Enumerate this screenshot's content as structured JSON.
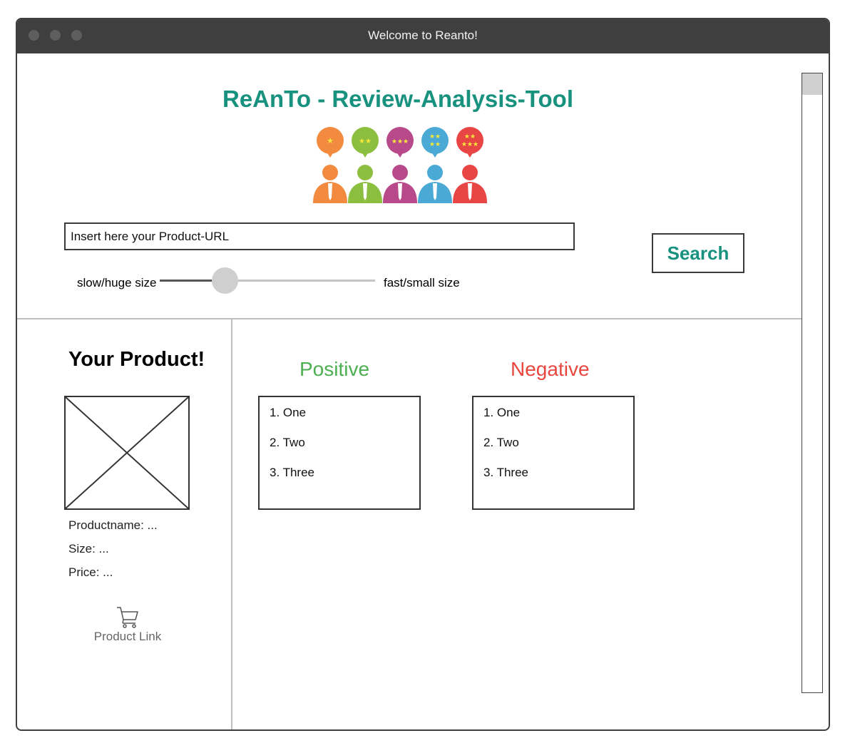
{
  "window": {
    "title": "Welcome to Reanto!"
  },
  "header": {
    "app_title": "ReAnTo - Review-Analysis-Tool",
    "logo_icon": "review-people-logo-icon"
  },
  "search": {
    "placeholder": "Insert here your Product-URL",
    "button_label": "Search"
  },
  "slider": {
    "left_label": "slow/huge size",
    "right_label": "fast/small size",
    "value_percent": 30
  },
  "product": {
    "heading": "Your Product!",
    "name_label": "Productname: ...",
    "size_label": "Size: ...",
    "price_label": "Price: ...",
    "link_label": "Product Link",
    "link_icon": "shopping-cart-icon"
  },
  "reviews": {
    "positive": {
      "heading": "Positive",
      "items": [
        "1. One",
        "2. Two",
        "3. Three"
      ]
    },
    "negative": {
      "heading": "Negative",
      "items": [
        "1. One",
        "2. Two",
        "3. Three"
      ]
    }
  },
  "colors": {
    "accent": "#18917e",
    "positive": "#4caf50",
    "negative": "#e8473f",
    "titlebar": "#3f3f3f",
    "logo": [
      "#f28b3f",
      "#8cbf3f",
      "#b84a8b",
      "#4ba9d5",
      "#e84545"
    ]
  }
}
